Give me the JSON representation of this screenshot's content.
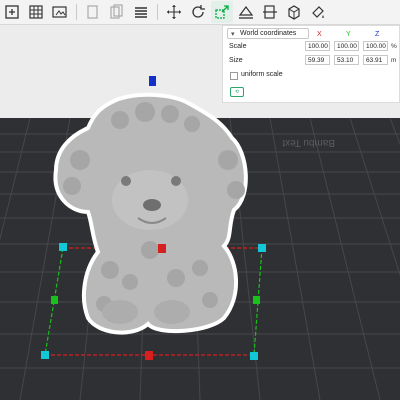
{
  "toolbar": {
    "icons": [
      "new-plate-icon",
      "grid-plate-icon",
      "edit-plate-icon",
      "copy-icon",
      "paste-icon",
      "delete-icon",
      "layers-icon",
      "move-icon",
      "rotate-icon",
      "scale-icon",
      "place-on-face-icon",
      "cut-icon",
      "assembly-icon",
      "paint-icon"
    ]
  },
  "panel": {
    "coordinate_system": "World coordinates",
    "axis_x": "X",
    "axis_y": "Y",
    "axis_z": "Z",
    "scale_label": "Scale",
    "scale_x": "100.00",
    "scale_y": "100.00",
    "scale_z": "100.00",
    "scale_unit": "%",
    "size_label": "Size",
    "size_x": "59.39",
    "size_y": "53.10",
    "size_z": "63.91",
    "size_unit": "m",
    "uniform_label": "uniform scale",
    "uniform_checked": false,
    "reset_label": "⟲"
  },
  "scene": {
    "bed_text": "Bambu Text"
  },
  "colors": {
    "bed": "#2f3033",
    "grid": "#45474b",
    "accent": "#00ae42",
    "model": "#b9b9b9",
    "scale_x": "#d61f1f",
    "scale_y": "#18c21b",
    "scale_z": "#1331c9",
    "handle_cyan": "#13c7d6"
  }
}
